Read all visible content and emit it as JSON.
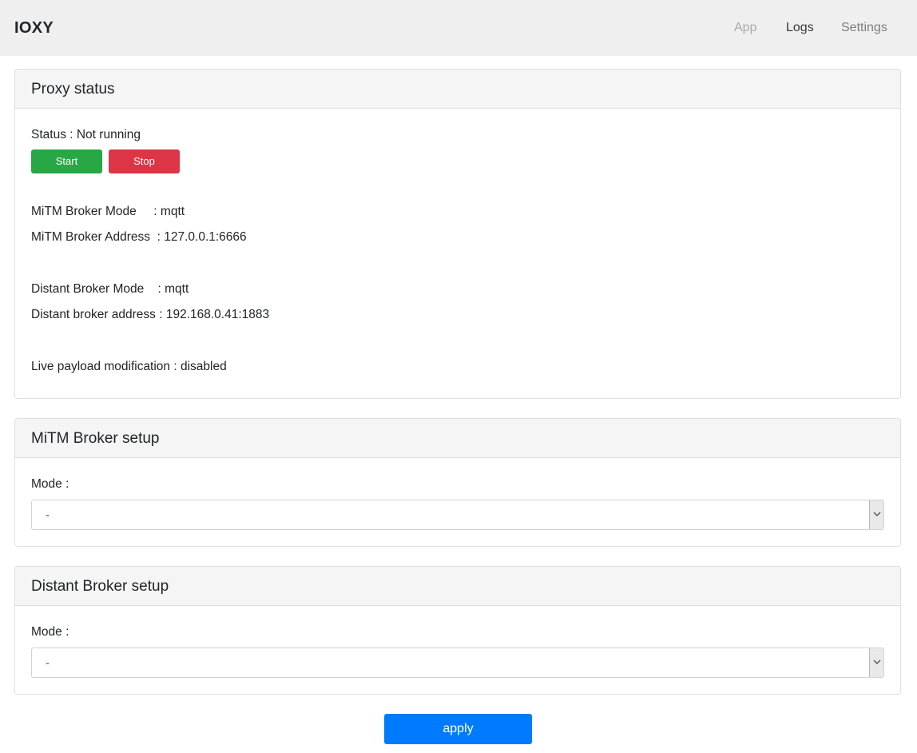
{
  "navbar": {
    "brand": "IOXY",
    "links": [
      {
        "label": "App"
      },
      {
        "label": "Logs"
      },
      {
        "label": "Settings"
      }
    ]
  },
  "proxy_status": {
    "title": "Proxy status",
    "status_line": "Status : Not running",
    "start_label": "Start",
    "stop_label": "Stop",
    "mitm_mode_line": "MiTM Broker Mode     : mqtt",
    "mitm_address_line": "MiTM Broker Address  : 127.0.0.1:6666",
    "distant_mode_line": "Distant Broker Mode    : mqtt",
    "distant_address_line": "Distant broker address : 192.168.0.41:1883",
    "payload_line": "Live payload modification : disabled"
  },
  "mitm_setup": {
    "title": "MiTM Broker setup",
    "mode_label": "Mode :",
    "mode_value": "-"
  },
  "distant_setup": {
    "title": "Distant Broker setup",
    "mode_label": "Mode :",
    "mode_value": "-"
  },
  "apply_label": "apply",
  "colors": {
    "start": "#28a745",
    "stop": "#dc3545",
    "apply": "#007bff",
    "navbar_bg": "#efefef"
  },
  "icons": {
    "select_arrow": "chevron-down-icon"
  }
}
